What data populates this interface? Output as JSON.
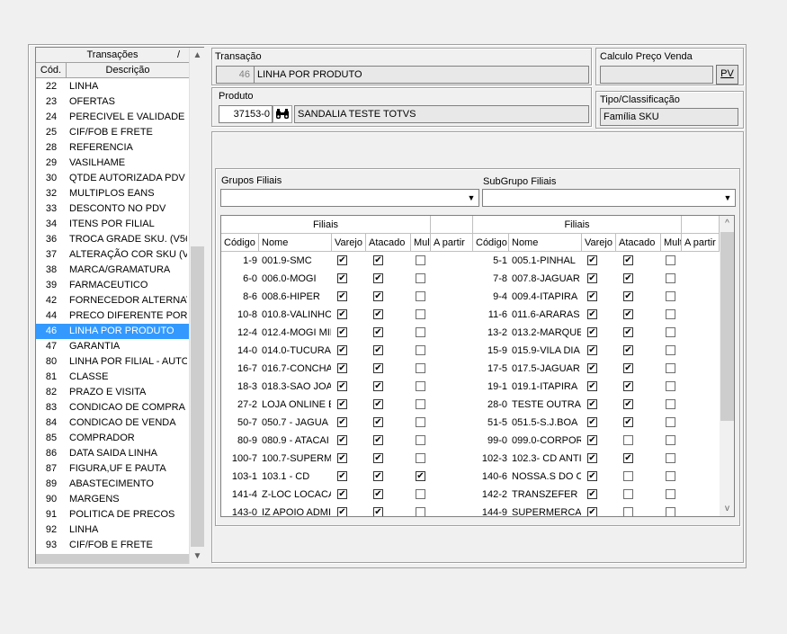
{
  "transactions_panel": {
    "title": "Transações",
    "title_marker": "/",
    "col_code": "Cód.",
    "col_desc": "Descrição",
    "rows": [
      {
        "code": "22",
        "desc": "LINHA"
      },
      {
        "code": "23",
        "desc": "OFERTAS"
      },
      {
        "code": "24",
        "desc": "PERECIVEL E VALIDADE"
      },
      {
        "code": "25",
        "desc": "CIF/FOB E FRETE"
      },
      {
        "code": "28",
        "desc": "REFERENCIA"
      },
      {
        "code": "29",
        "desc": "VASILHAME"
      },
      {
        "code": "30",
        "desc": "QTDE AUTORIZADA PDV"
      },
      {
        "code": "32",
        "desc": "MULTIPLOS EANS"
      },
      {
        "code": "33",
        "desc": "DESCONTO NO PDV"
      },
      {
        "code": "34",
        "desc": "ITENS POR FILIAL"
      },
      {
        "code": "36",
        "desc": "TROCA GRADE SKU. (V56"
      },
      {
        "code": "37",
        "desc": "ALTERAÇÃO COR SKU (V5"
      },
      {
        "code": "38",
        "desc": "MARCA/GRAMATURA"
      },
      {
        "code": "39",
        "desc": "FARMACEUTICO"
      },
      {
        "code": "42",
        "desc": "FORNECEDOR ALTERNATIV"
      },
      {
        "code": "44",
        "desc": "PRECO DIFERENTE POR LC"
      },
      {
        "code": "46",
        "desc": "LINHA POR PRODUTO",
        "selected": true
      },
      {
        "code": "47",
        "desc": "GARANTIA"
      },
      {
        "code": "80",
        "desc": "LINHA POR FILIAL - AUTOM"
      },
      {
        "code": "81",
        "desc": "CLASSE"
      },
      {
        "code": "82",
        "desc": "PRAZO E VISITA"
      },
      {
        "code": "83",
        "desc": "CONDICAO DE COMPRA"
      },
      {
        "code": "84",
        "desc": "CONDICAO DE VENDA"
      },
      {
        "code": "85",
        "desc": "COMPRADOR"
      },
      {
        "code": "86",
        "desc": "DATA SAIDA LINHA"
      },
      {
        "code": "87",
        "desc": "FIGURA,UF E PAUTA"
      },
      {
        "code": "89",
        "desc": "ABASTECIMENTO"
      },
      {
        "code": "90",
        "desc": "MARGENS"
      },
      {
        "code": "91",
        "desc": "POLITICA DE PRECOS"
      },
      {
        "code": "92",
        "desc": "LINHA"
      },
      {
        "code": "93",
        "desc": "CIF/FOB E FRETE"
      }
    ]
  },
  "transacao": {
    "label": "Transação",
    "code": "46",
    "desc": "LINHA POR PRODUTO"
  },
  "produto": {
    "label": "Produto",
    "code": "37153-0",
    "desc": "SANDALIA TESTE TOTVS"
  },
  "calculo": {
    "label": "Calculo Preço Venda",
    "value": "",
    "button": "PV"
  },
  "tipo": {
    "label": "Tipo/Classificação",
    "value": "Família SKU"
  },
  "grupos": {
    "label": "Grupos Filiais",
    "value": ""
  },
  "subgrupo": {
    "label": "SubGrupo Filiais",
    "value": ""
  },
  "grid": {
    "group_header": "Filiais",
    "columns": [
      "Código",
      "Nome",
      "Varejo",
      "Atacado",
      "Mult",
      "A partir"
    ],
    "left_rows": [
      {
        "code": "1-9",
        "name": "001.9-SMC",
        "varejo": true,
        "atacado": true,
        "mult": false
      },
      {
        "code": "6-0",
        "name": "006.0-MOGI",
        "varejo": true,
        "atacado": true,
        "mult": false
      },
      {
        "code": "8-6",
        "name": "008.6-HIPER",
        "varejo": true,
        "atacado": true,
        "mult": false
      },
      {
        "code": "10-8",
        "name": "010.8-VALINHC",
        "varejo": true,
        "atacado": true,
        "mult": false
      },
      {
        "code": "12-4",
        "name": "012.4-MOGI MIF",
        "varejo": true,
        "atacado": true,
        "mult": false
      },
      {
        "code": "14-0",
        "name": "014.0-TUCURA",
        "varejo": true,
        "atacado": true,
        "mult": false
      },
      {
        "code": "16-7",
        "name": "016.7-CONCHA",
        "varejo": true,
        "atacado": true,
        "mult": false
      },
      {
        "code": "18-3",
        "name": "018.3-SAO JOA",
        "varejo": true,
        "atacado": true,
        "mult": false
      },
      {
        "code": "27-2",
        "name": "LOJA ONLINE E",
        "varejo": true,
        "atacado": true,
        "mult": false
      },
      {
        "code": "50-7",
        "name": "050.7 - JAGUA",
        "varejo": true,
        "atacado": true,
        "mult": false
      },
      {
        "code": "80-9",
        "name": "080.9 - ATACAI",
        "varejo": true,
        "atacado": true,
        "mult": false
      },
      {
        "code": "100-7",
        "name": "100.7-SUPERMI",
        "varejo": true,
        "atacado": true,
        "mult": false
      },
      {
        "code": "103-1",
        "name": "103.1 - CD",
        "varejo": true,
        "atacado": true,
        "mult": true
      },
      {
        "code": "141-4",
        "name": "Z-LOC LOCACA",
        "varejo": true,
        "atacado": true,
        "mult": false
      },
      {
        "code": "143-0",
        "name": "IZ APOIO ADMIN",
        "varejo": true,
        "atacado": true,
        "mult": false
      }
    ],
    "right_rows": [
      {
        "code": "5-1",
        "name": "005.1-PINHAL",
        "varejo": true,
        "atacado": true,
        "mult": false
      },
      {
        "code": "7-8",
        "name": "007.8-JAGUAR",
        "varejo": true,
        "atacado": true,
        "mult": false
      },
      {
        "code": "9-4",
        "name": "009.4-ITAPIRA",
        "varejo": true,
        "atacado": true,
        "mult": false
      },
      {
        "code": "11-6",
        "name": "011.6-ARARAS",
        "varejo": true,
        "atacado": true,
        "mult": false
      },
      {
        "code": "13-2",
        "name": "013.2-MARQUE",
        "varejo": true,
        "atacado": true,
        "mult": false
      },
      {
        "code": "15-9",
        "name": "015.9-VILA DIA",
        "varejo": true,
        "atacado": true,
        "mult": false
      },
      {
        "code": "17-5",
        "name": "017.5-JAGUAR",
        "varejo": true,
        "atacado": true,
        "mult": false
      },
      {
        "code": "19-1",
        "name": "019.1-ITAPIRA",
        "varejo": true,
        "atacado": true,
        "mult": false
      },
      {
        "code": "28-0",
        "name": "TESTE OUTRA I",
        "varejo": true,
        "atacado": true,
        "mult": false
      },
      {
        "code": "51-5",
        "name": "051.5-S.J.BOA",
        "varejo": true,
        "atacado": true,
        "mult": false
      },
      {
        "code": "99-0",
        "name": "099.0-CORPOR",
        "varejo": true,
        "atacado": false,
        "mult": false
      },
      {
        "code": "102-3",
        "name": "102.3- CD ANTI",
        "varejo": true,
        "atacado": true,
        "mult": false
      },
      {
        "code": "140-6",
        "name": "NOSSA.S DO C",
        "varejo": true,
        "atacado": false,
        "mult": false
      },
      {
        "code": "142-2",
        "name": "TRANSZEFER",
        "varejo": true,
        "atacado": false,
        "mult": false
      },
      {
        "code": "144-9",
        "name": "SUPERMERCAD",
        "varejo": true,
        "atacado": false,
        "mult": false
      }
    ]
  },
  "icons": {
    "check": "✔",
    "binoculars": "binoculars-icon"
  }
}
